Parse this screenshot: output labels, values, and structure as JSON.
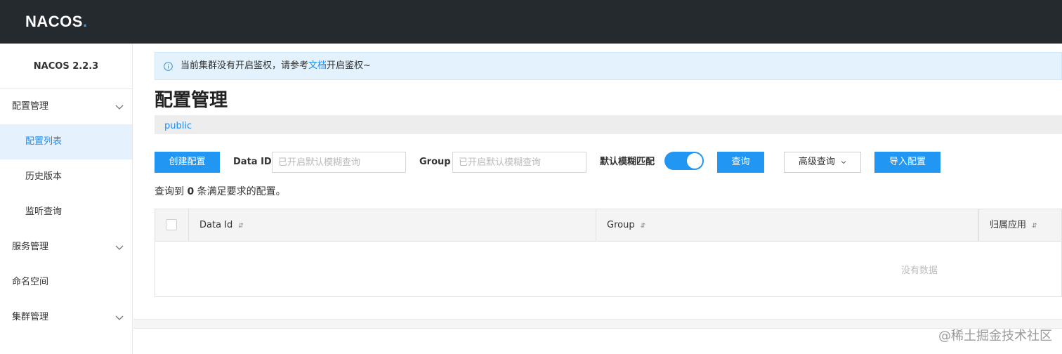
{
  "header": {
    "logo_text": "NACOS",
    "logo_dot": "."
  },
  "sidebar": {
    "version": "NACOS 2.2.3",
    "groups": [
      {
        "label": "配置管理",
        "expanded": true,
        "items": [
          "配置列表",
          "历史版本",
          "监听查询"
        ],
        "active_item": "配置列表"
      },
      {
        "label": "服务管理",
        "expanded": false
      },
      {
        "label": "命名空间"
      },
      {
        "label": "集群管理",
        "expanded": false
      }
    ]
  },
  "notice": {
    "icon": "info-icon",
    "text_before": "当前集群没有开启鉴权，请参考",
    "link_text": "文档",
    "text_after": "开启鉴权~"
  },
  "page": {
    "title": "配置管理",
    "namespace": "public"
  },
  "toolbar": {
    "create_label": "创建配置",
    "data_id_label": "Data ID",
    "data_id_placeholder": "已开启默认模糊查询",
    "group_label": "Group",
    "group_placeholder": "已开启默认模糊查询",
    "fuzzy_label": "默认模糊匹配",
    "fuzzy_enabled": true,
    "query_label": "查询",
    "advanced_label": "高级查询",
    "import_label": "导入配置"
  },
  "result": {
    "prefix": "查询到",
    "count": "0",
    "suffix": "条满足要求的配置。"
  },
  "table": {
    "columns": [
      "Data Id",
      "Group",
      "归属应用"
    ],
    "sort_icon": "⇵",
    "empty_text": "没有数据"
  },
  "watermark": "@稀土掘金技术社区",
  "colors": {
    "topbar": "#252a2f",
    "primary": "#2196f3",
    "link": "#1e8bf0",
    "active_bg": "#e5f2fd"
  }
}
